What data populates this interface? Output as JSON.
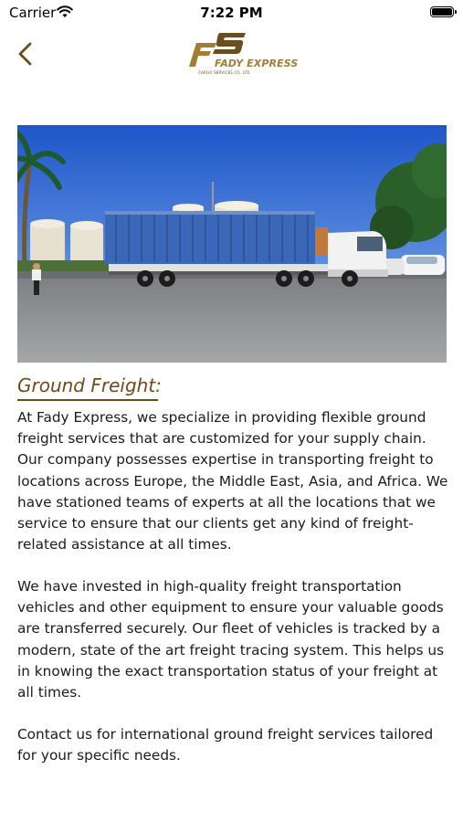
{
  "status_bar": {
    "carrier": "Carrier",
    "time": "7:22 PM"
  },
  "header": {
    "logo_name": "FADY EXPRESS",
    "logo_subtitle": "CARGO SERVICES CO. LTD.",
    "brand_color": "#a67b33"
  },
  "section": {
    "title": "Ground Freight:",
    "paragraphs": [
      "At Fady Express, we specialize in providing flexible ground freight services that are customized for your supply chain. Our company possesses expertise in transporting freight to locations across Europe, the Middle East, Asia, and Africa. We have stationed teams of experts at all the locations that we service to ensure that our clients get any kind of freight-related assistance at all times.",
      "We have invested in high-quality freight transportation vehicles and other equipment to ensure your valuable goods are transferred securely. Our fleet of vehicles is tracked by a modern, state of the art freight tracing system. This helps us in knowing the exact transportation status of your freight at all times.",
      "Contact us for international ground freight services tailored for your specific needs."
    ]
  },
  "icons": {
    "back": "chevron-left-icon",
    "wifi": "wifi-icon",
    "battery": "battery-icon"
  }
}
